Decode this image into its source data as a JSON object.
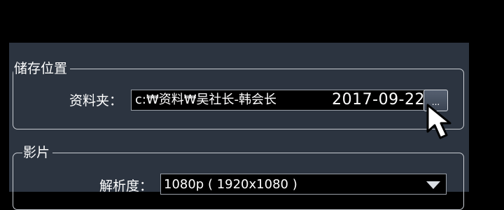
{
  "storage": {
    "title": "储存位置",
    "folder_label": "资料夹：",
    "folder_path": "c:₩资料₩吴社长-韩会长",
    "folder_date": "2017-09-22",
    "browse_label": "..."
  },
  "video": {
    "title": "影片",
    "resolution_label": "解析度：",
    "resolution_value": "1080p ( 1920x1080 )"
  },
  "icons": {
    "dropdown": "chevron-down-icon",
    "cursor": "mouse-pointer-icon"
  },
  "colors": {
    "dialog_bg": "#2c3440",
    "field_bg": "#000000",
    "border": "#c9cdd3"
  }
}
